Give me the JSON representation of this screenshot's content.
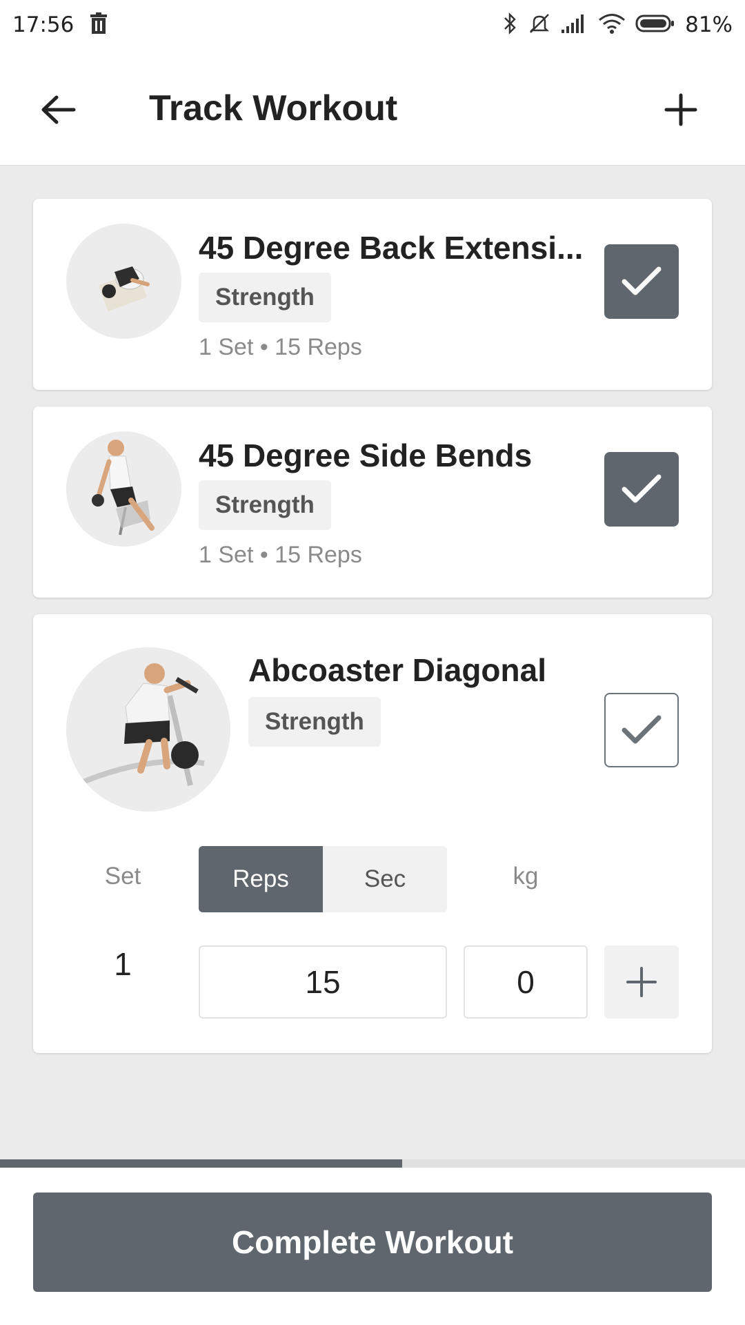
{
  "status_bar": {
    "time": "17:56",
    "battery_percent": "81%",
    "icons": [
      "trash-icon",
      "bluetooth-icon",
      "mute-icon",
      "signal-icon",
      "wifi-icon",
      "battery-icon"
    ]
  },
  "header": {
    "title": "Track Workout",
    "back_icon": "arrow-left-icon",
    "add_icon": "plus-icon"
  },
  "exercises": [
    {
      "name": "45 Degree Back Extensi...",
      "category": "Strength",
      "summary": "1 Set • 15 Reps",
      "completed": true
    },
    {
      "name": "45 Degree Side Bends",
      "category": "Strength",
      "summary": "1 Set • 15 Reps",
      "completed": true
    },
    {
      "name": "Abcoaster Diagonal",
      "category": "Strength",
      "summary": "",
      "completed": false
    }
  ],
  "set_editor": {
    "set_label": "Set",
    "reps_label": "Reps",
    "sec_label": "Sec",
    "weight_label": "kg",
    "active_mode": "Reps",
    "rows": [
      {
        "set": "1",
        "reps": "15",
        "weight": "0"
      }
    ]
  },
  "progress": {
    "fraction": 0.54
  },
  "footer": {
    "complete_label": "Complete Workout"
  },
  "colors": {
    "accent": "#5f666d",
    "background": "#ebebeb",
    "card": "#ffffff"
  }
}
